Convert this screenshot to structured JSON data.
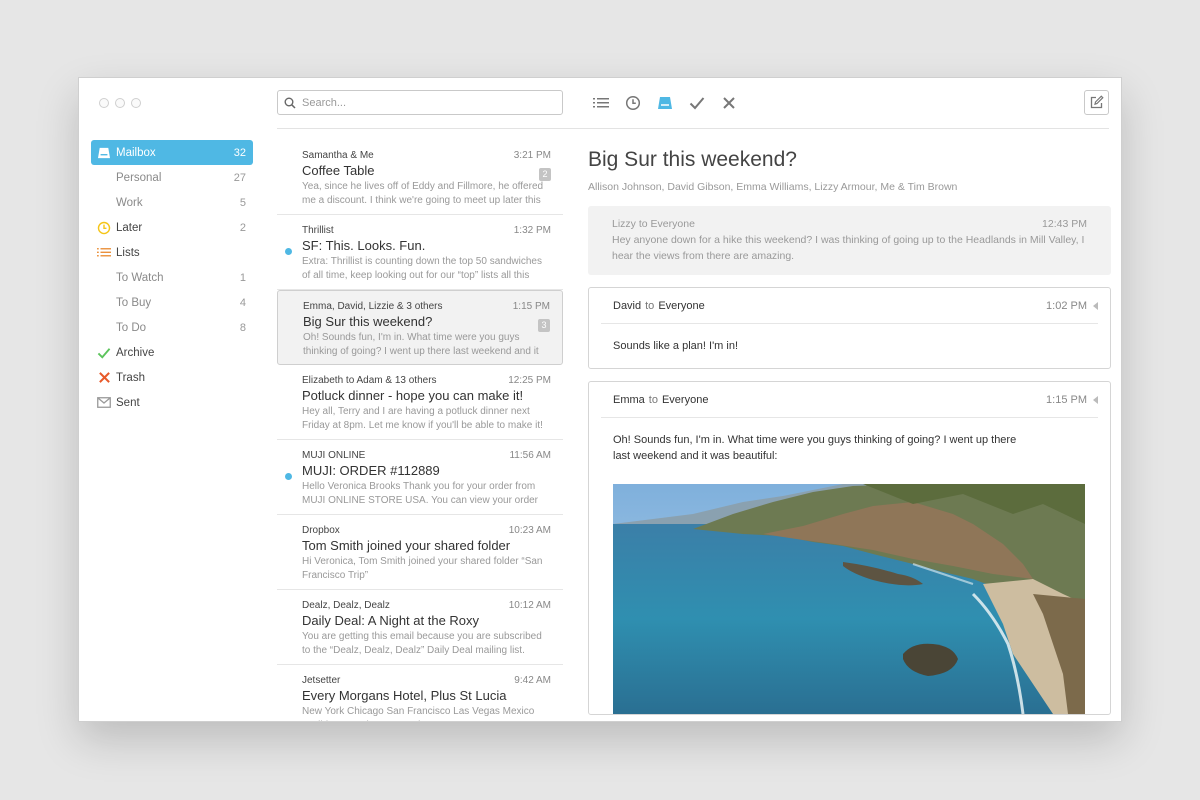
{
  "search": {
    "placeholder": "Search..."
  },
  "toolbar": {
    "icons": [
      "list-icon",
      "clock-icon",
      "mailbox-icon",
      "check-icon",
      "close-icon",
      "compose-icon"
    ]
  },
  "colors": {
    "accent": "#4fb8e4",
    "later": "#f5c518",
    "lists": "#e9892f",
    "archive": "#5cc45c",
    "trash": "#e85a2a"
  },
  "sidebar": {
    "items": [
      {
        "label": "Mailbox",
        "count": "32",
        "icon": "mailbox-icon",
        "active": true
      },
      {
        "label": "Personal",
        "count": "27"
      },
      {
        "label": "Work",
        "count": "5"
      },
      {
        "label": "Later",
        "count": "2",
        "icon": "clock-icon"
      },
      {
        "label": "Lists",
        "count": "",
        "icon": "list-icon"
      },
      {
        "label": "To Watch",
        "count": "1"
      },
      {
        "label": "To Buy",
        "count": "4"
      },
      {
        "label": "To Do",
        "count": "8"
      },
      {
        "label": "Archive",
        "count": "",
        "icon": "check-icon"
      },
      {
        "label": "Trash",
        "count": "",
        "icon": "x-icon"
      },
      {
        "label": "Sent",
        "count": "",
        "icon": "envelope-icon"
      }
    ]
  },
  "messages": [
    {
      "from": "Samantha & Me",
      "time": "3:21 PM",
      "subject": "Coffee Table",
      "preview": "Yea, since he lives off of Eddy and Fillmore, he offered me a discount. I think we're going to meet up later this",
      "badge": "2",
      "unread": false
    },
    {
      "from": "Thrillist",
      "time": "1:32 PM",
      "subject": "SF: This. Looks. Fun.",
      "preview": "Extra: Thrillist is counting down the top 50 sandwiches of all time, keep looking out for our “top” lists all this",
      "badge": "",
      "unread": true
    },
    {
      "from": "Emma, David, Lizzie & 3 others",
      "time": "1:15 PM",
      "subject": "Big Sur this weekend?",
      "preview": "Oh! Sounds fun, I'm in. What time were you guys thinking of going? I went up there last weekend and it",
      "badge": "3",
      "unread": false,
      "selected": true
    },
    {
      "from": "Elizabeth to Adam & 13 others",
      "time": "12:25 PM",
      "subject": "Potluck dinner - hope you can make it!",
      "preview": "Hey all, Terry and I are having a potluck dinner next Friday at 8pm. Let me know if you'll be able to make it!",
      "badge": "",
      "unread": false
    },
    {
      "from": "MUJI ONLINE",
      "time": "11:56 AM",
      "subject": "MUJI: ORDER #112889",
      "preview": "Hello Veronica Brooks Thank you for your order from MUJI ONLINE STORE USA. You can view your order",
      "badge": "",
      "unread": true
    },
    {
      "from": "Dropbox",
      "time": "10:23 AM",
      "subject": "Tom Smith joined your shared folder",
      "preview": "Hi Veronica, Tom Smith joined your shared folder “San Francisco Trip”",
      "badge": "",
      "unread": false
    },
    {
      "from": "Dealz, Dealz, Dealz",
      "time": "10:12 AM",
      "subject": "Daily Deal: A Night at the Roxy",
      "preview": "You are getting this email because you are subscribed to the “Dealz, Dealz, Dealz” Daily Deal mailing list.",
      "badge": "",
      "unread": false
    },
    {
      "from": "Jetsetter",
      "time": "9:42 AM",
      "subject": "Every Morgans Hotel, Plus St Lucia",
      "preview": "New York Chicago San Francisco Las Vegas Mexico Caribbean Paris Los Angeles",
      "badge": "",
      "unread": false
    }
  ],
  "thread": {
    "title": "Big Sur this weekend?",
    "participants": "Allison Johnson, David Gibson, Emma Williams, Lizzy Armour, Me & Tim Brown",
    "to_word": "to",
    "replies": [
      {
        "sender": "Lizzy",
        "recipient": "Everyone",
        "time": "12:43 PM",
        "body": "Hey anyone down for a hike this weekend? I was thinking of going up to the Headlands in Mill Valley, I hear the views from there are amazing."
      },
      {
        "sender": "David",
        "recipient": "Everyone",
        "time": "1:02 PM",
        "body": "Sounds like a plan! I'm in!"
      },
      {
        "sender": "Emma",
        "recipient": "Everyone",
        "time": "1:15 PM",
        "body": "Oh! Sounds fun, I'm in. What time were you guys thinking of going? I went up there last weekend and it was beautiful:"
      }
    ]
  }
}
